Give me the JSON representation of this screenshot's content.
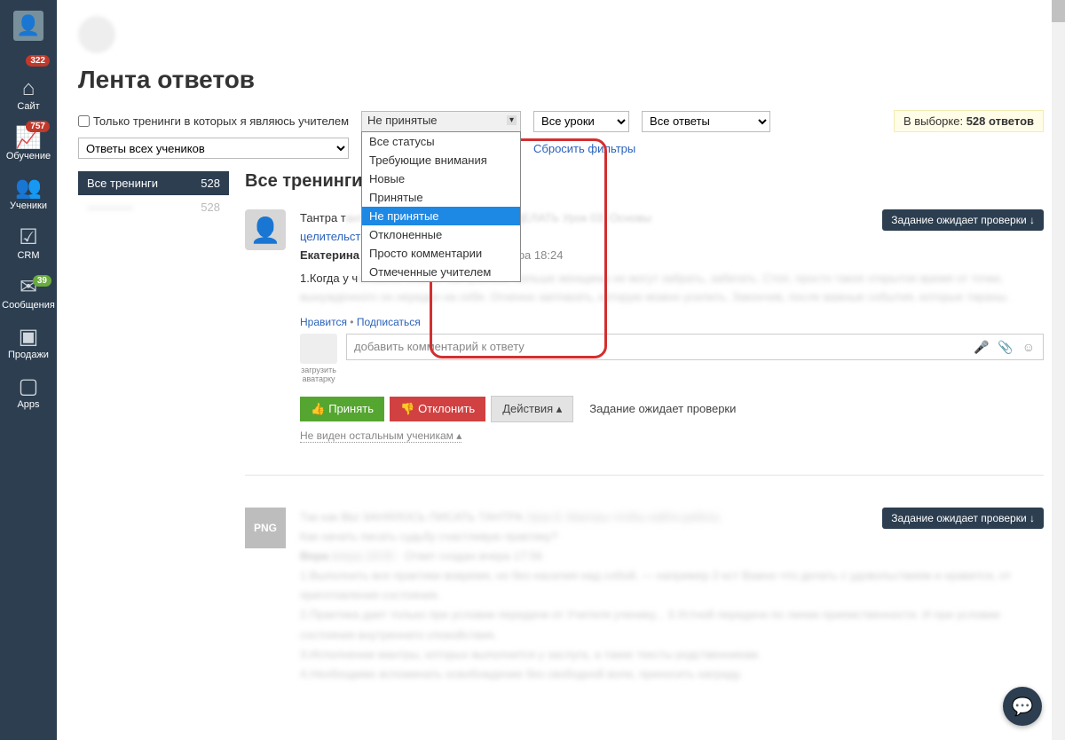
{
  "sidebar": {
    "items": [
      {
        "icon": "👤",
        "label": "",
        "badge": "322",
        "bclass": ""
      },
      {
        "icon": "⌂",
        "label": "Сайт",
        "badge": "",
        "bclass": ""
      },
      {
        "icon": "📈",
        "label": "Обучение",
        "badge": "757",
        "bclass": ""
      },
      {
        "icon": "👥",
        "label": "Ученики",
        "badge": "",
        "bclass": ""
      },
      {
        "icon": "☑",
        "label": "CRM",
        "badge": "",
        "bclass": ""
      },
      {
        "icon": "✉",
        "label": "Сообщения",
        "badge": "39",
        "bclass": "green"
      },
      {
        "icon": "▣",
        "label": "Продажи",
        "badge": "",
        "bclass": ""
      },
      {
        "icon": "▢",
        "label": "Apps",
        "badge": "",
        "bclass": ""
      }
    ]
  },
  "page": {
    "title": "Лента ответов"
  },
  "filters": {
    "teacher_only_label": "Только тренинги в которых я являюсь учителем",
    "status_selected": "Не принятые",
    "status_options": [
      "Все статусы",
      "Требующие внимания",
      "Новые",
      "Принятые",
      "Не принятые",
      "Отклоненные",
      "Просто комментарии",
      "Отмеченные учителем"
    ],
    "lessons_selected": "Все уроки",
    "answers_selected": "Все ответы",
    "students_selected": "Ответы всех учеников",
    "reset_label": "Сбросить фильтры",
    "selection_prefix": "В выборке: ",
    "selection_count": "528 ответов"
  },
  "trainings": {
    "all_label": "Все тренинги",
    "all_count": "528",
    "row2_count": "528"
  },
  "content_heading": "Все тренинги",
  "answer1": {
    "course_prefix": "Тантра т",
    "course_blur": "целительст",
    "author": "Екатерина",
    "created": "создан вчера 18:24",
    "body_start": "1.Когда у ч",
    "status_pill": "Задание ожидает проверки ↓",
    "like": "Нравится",
    "subscribe": "Подписаться",
    "comment_placeholder": "добавить комментарий к ответу",
    "avatar_hint": "загрузить аватарку",
    "accept": "Принять",
    "reject": "Отклонить",
    "actions_label": "Действия ▴",
    "await_text": "Задание ожидает проверки",
    "visibility": "Не виден остальным ученикам ▴"
  },
  "answer2": {
    "png": "PNG",
    "status_pill": "Задание ожидает проверки ↓"
  }
}
